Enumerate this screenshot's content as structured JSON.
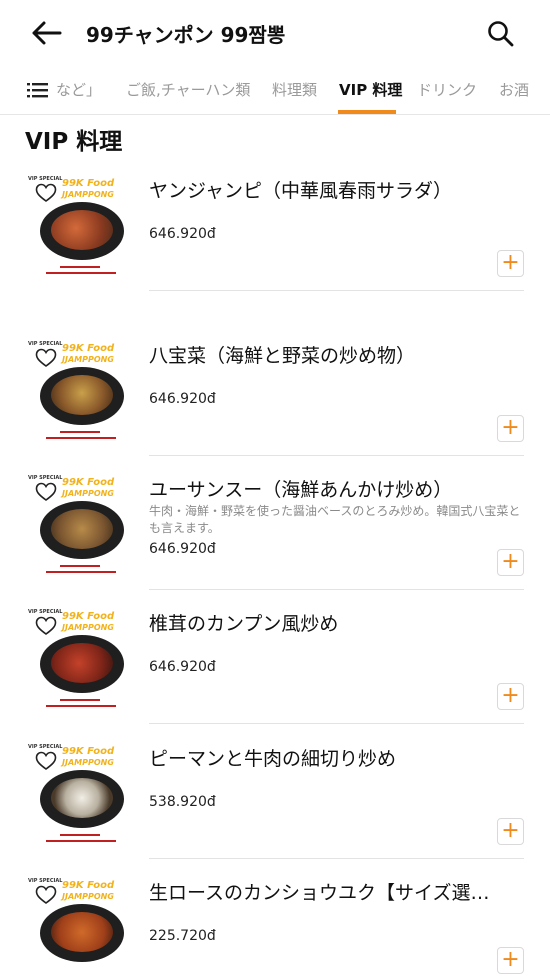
{
  "header": {
    "title": "99チャンポン 99짬뽕",
    "back_icon": "arrow-left-icon",
    "search_icon": "search-icon"
  },
  "tabs": {
    "menu_icon": "list-icon",
    "items": [
      {
        "label": "など」",
        "active": false
      },
      {
        "label": "ご飯,チャーハン類",
        "active": false
      },
      {
        "label": "料理類",
        "active": false
      },
      {
        "label": "VIP 料理",
        "active": true
      },
      {
        "label": "ドリンク",
        "active": false
      },
      {
        "label": "お酒",
        "active": false
      }
    ]
  },
  "section": {
    "title": "VIP 料理"
  },
  "thumb_text": {
    "brand1": "99K Food",
    "brand2": "JJAMPPONG",
    "tag": "VIP SPECIAL"
  },
  "colors": {
    "accent": "#f08a1c",
    "brand_yellow": "#f2b21b"
  },
  "items": [
    {
      "name": "ヤンジャンピ（中華風春雨サラダ）",
      "description": "",
      "price": "646.920đ"
    },
    {
      "name": "八宝菜（海鮮と野菜の炒め物）",
      "description": "",
      "price": "646.920đ"
    },
    {
      "name": "ユーサンスー（海鮮あんかけ炒め）",
      "description": "牛肉・海鮮・野菜を使った醤油ベースのとろみ炒め。韓国式八宝菜とも言えます。",
      "price": "646.920đ"
    },
    {
      "name": "椎茸のカンプン風炒め",
      "description": "",
      "price": "646.920đ"
    },
    {
      "name": "ピーマンと牛肉の細切り炒め",
      "description": "",
      "price": "538.920đ"
    },
    {
      "name": "生ロースのカンショウユク【サイズ選…",
      "description": "",
      "price": "225.720đ"
    }
  ]
}
